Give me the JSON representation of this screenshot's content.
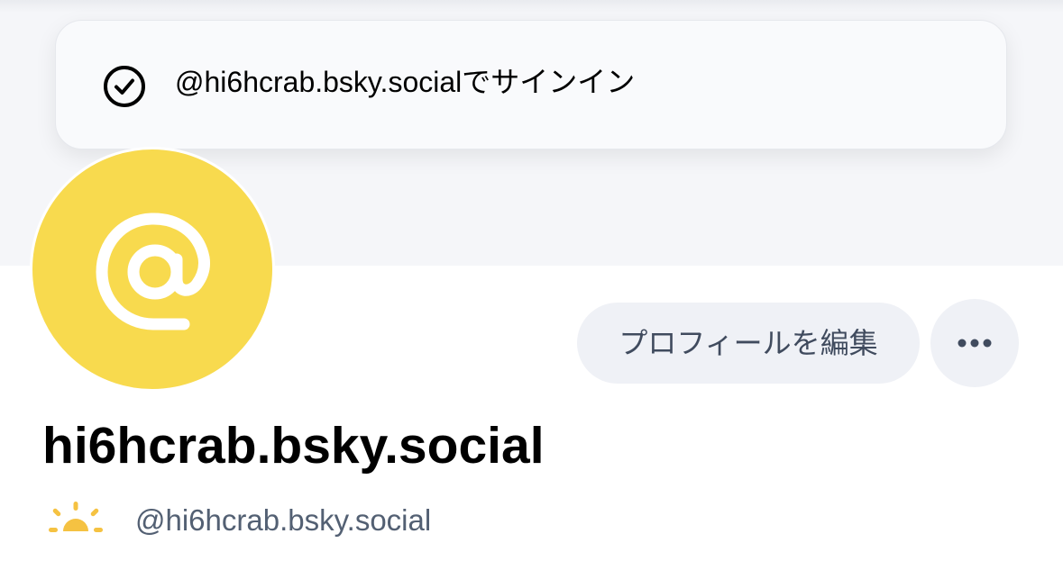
{
  "toast": {
    "message": "@hi6hcrab.bsky.socialでサインイン",
    "icon": "check-circle-icon"
  },
  "profile": {
    "avatar_icon": "at-sign-icon",
    "avatar_color": "#f8da4e",
    "display_name": "hi6hcrab.bsky.social",
    "handle": "@hi6hcrab.bsky.social",
    "handle_icon": "sunrise-icon",
    "handle_icon_color": "#f5c242"
  },
  "actions": {
    "edit_profile_label": "プロフィールを編集",
    "more_icon": "ellipsis-icon"
  },
  "colors": {
    "banner": "#f5f6f9",
    "button_bg": "#eff1f6",
    "button_text": "#404b5e",
    "secondary_text": "#536073"
  }
}
